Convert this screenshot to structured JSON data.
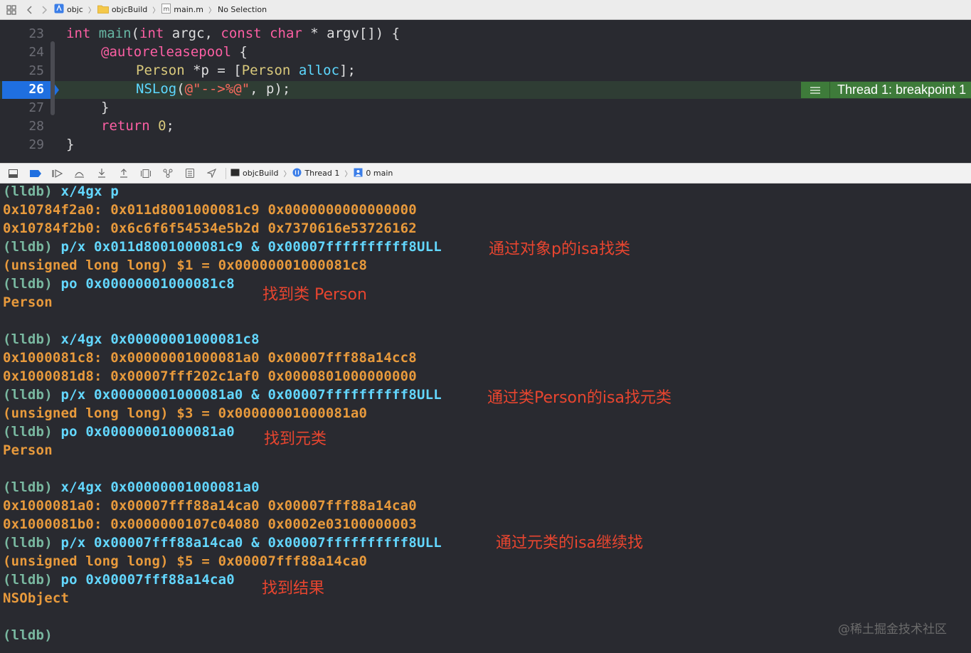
{
  "jumpbar": {
    "crumbs": [
      "objc",
      "objcBuild",
      "main.m",
      "No Selection"
    ]
  },
  "editor": {
    "line_numbers": [
      "23",
      "24",
      "25",
      "26",
      "27",
      "28",
      "29"
    ],
    "current_line": "26",
    "code": {
      "l23": {
        "kw1": "int",
        "fn": "main",
        "p1": "(",
        "kw2": "int",
        "a1": " argc, ",
        "kw3": "const",
        "sp": " ",
        "kw4": "char",
        "rest": " * argv[]) {"
      },
      "l24": {
        "at": "@autoreleasepool",
        "rest": " {"
      },
      "l25": {
        "cls": "Person",
        "mid": " *p = [",
        "cls2": "Person",
        "sp": " ",
        "msg": "alloc",
        "end": "];"
      },
      "l26": {
        "fn": "NSLog",
        "p": "(",
        "str": "@\"-->%@\"",
        "rest": ", p);"
      },
      "l27": "}",
      "l28": {
        "kw": "return",
        "sp": " ",
        "num": "0",
        "end": ";"
      },
      "l29": "}"
    },
    "thread_badge": "Thread 1: breakpoint 1"
  },
  "debugbar": {
    "path": [
      "objcBuild",
      "Thread 1",
      "0 main"
    ]
  },
  "console": {
    "lines": [
      {
        "p": "(lldb)",
        "c": " x/4gx p"
      },
      {
        "o": "0x10784f2a0: 0x011d8001000081c9 0x0000000000000000"
      },
      {
        "o": "0x10784f2b0: 0x6c6f6f54534e5b2d 0x7370616e53726162"
      },
      {
        "p": "(lldb)",
        "c": " p/x 0x011d8001000081c9 & 0x00007ffffffffff8ULL"
      },
      {
        "o": "(unsigned long long) $1 = 0x00000001000081c8"
      },
      {
        "p": "(lldb)",
        "c": " po 0x00000001000081c8"
      },
      {
        "o": "Person"
      },
      {
        "p": "(lldb)",
        "c": " x/4gx 0x00000001000081c8"
      },
      {
        "o": "0x1000081c8: 0x00000001000081a0 0x00007fff88a14cc8"
      },
      {
        "o": "0x1000081d8: 0x00007fff202c1af0 0x0000801000000000"
      },
      {
        "p": "(lldb)",
        "c": " p/x 0x00000001000081a0 & 0x00007ffffffffff8ULL"
      },
      {
        "o": "(unsigned long long) $3 = 0x00000001000081a0"
      },
      {
        "p": "(lldb)",
        "c": " po 0x00000001000081a0"
      },
      {
        "o": "Person"
      },
      {
        "p": "(lldb)",
        "c": " x/4gx 0x00000001000081a0"
      },
      {
        "o": "0x1000081a0: 0x00007fff88a14ca0 0x00007fff88a14ca0"
      },
      {
        "o": "0x1000081b0: 0x0000000107c04080 0x0002e03100000003"
      },
      {
        "p": "(lldb)",
        "c": " p/x 0x00007fff88a14ca0 & 0x00007ffffffffff8ULL"
      },
      {
        "o": "(unsigned long long) $5 = 0x00007fff88a14ca0"
      },
      {
        "p": "(lldb)",
        "c": " po 0x00007fff88a14ca0"
      },
      {
        "o": "NSObject"
      },
      {
        "p": "(lldb)",
        "c": ""
      }
    ],
    "annotations": [
      "通过对象p的isa找类",
      "找到类 Person",
      "通过类Person的isa找元类",
      "找到元类",
      "通过元类的isa继续找",
      "找到结果"
    ]
  },
  "watermark": "@稀土掘金技术社区",
  "colors": {
    "prompt": "#79b8a0",
    "command": "#63d7ff",
    "output": "#e89a3c",
    "annotation": "#e8452f",
    "breakpoint": "#1f6fe0"
  }
}
